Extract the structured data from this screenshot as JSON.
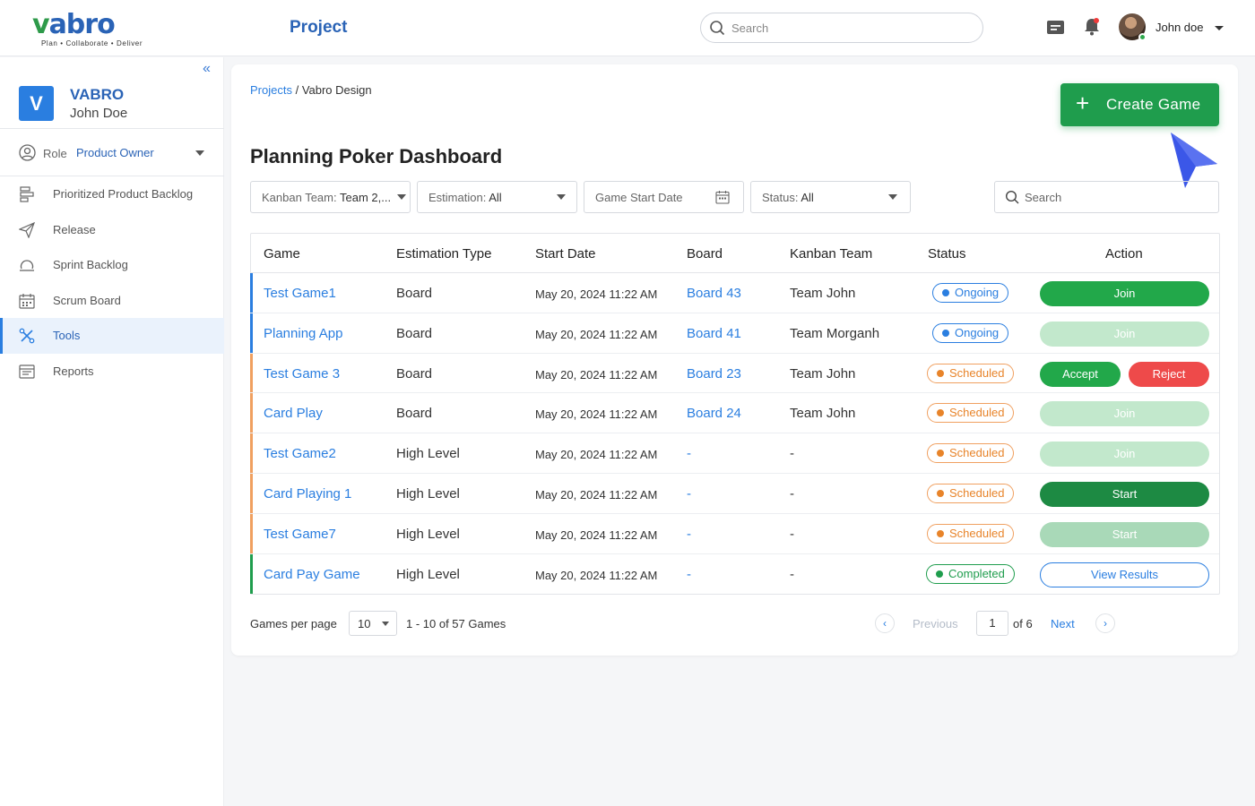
{
  "brand": {
    "logo_word": "vabro",
    "tagline": "Plan • Collaborate • Deliver"
  },
  "header": {
    "title": "Project",
    "search_placeholder": "Search",
    "user_name": "John doe"
  },
  "sidebar": {
    "project_initial": "V",
    "project_name": "VABRO",
    "project_owner": "John Doe",
    "role_label": "Role",
    "role_value": "Product Owner",
    "items": [
      {
        "label": "Prioritized Product Backlog",
        "icon": "backlog-icon"
      },
      {
        "label": "Release",
        "icon": "send-icon"
      },
      {
        "label": "Sprint Backlog",
        "icon": "sprint-icon"
      },
      {
        "label": "Scrum Board",
        "icon": "calendar-icon"
      },
      {
        "label": "Tools",
        "icon": "tools-icon",
        "active": true
      },
      {
        "label": "Reports",
        "icon": "reports-icon"
      }
    ]
  },
  "breadcrumb": {
    "root": "Projects",
    "separator": " / ",
    "current": "Vabro Design"
  },
  "create_button": "Create Game",
  "dashboard_title": "Planning Poker Dashboard",
  "filters": {
    "kanban_label": "Kanban Team:",
    "kanban_value": "Team 2,...",
    "estimation_label": "Estimation:",
    "estimation_value": "All",
    "start_date_placeholder": "Game Start Date",
    "status_label": "Status:",
    "status_value": "All",
    "search_placeholder": "Search"
  },
  "table": {
    "columns": [
      "Game",
      "Estimation Type",
      "Start Date",
      "Board",
      "Kanban Team",
      "Status",
      "Action"
    ],
    "rows": [
      {
        "game": "Test Game1",
        "type": "Board",
        "date": "May 20, 2024 11:22 AM",
        "board": "Board 43",
        "team": "Team John",
        "status": "Ongoing",
        "actions": [
          "Join"
        ]
      },
      {
        "game": "Planning App",
        "type": "Board",
        "date": "May 20, 2024 11:22 AM",
        "board": "Board 41",
        "team": "Team Morganh",
        "status": "Ongoing",
        "actions": [
          "Join"
        ]
      },
      {
        "game": "Test Game 3",
        "type": "Board",
        "date": "May 20, 2024 11:22 AM",
        "board": "Board 23",
        "team": "Team John",
        "status": "Scheduled",
        "actions": [
          "Accept",
          "Reject"
        ]
      },
      {
        "game": "Card Play",
        "type": "Board",
        "date": "May 20, 2024 11:22 AM",
        "board": "Board 24",
        "team": "Team John",
        "status": "Scheduled",
        "actions": [
          "Join"
        ]
      },
      {
        "game": "Test Game2",
        "type": "High Level",
        "date": "May 20, 2024 11:22 AM",
        "board": "-",
        "team": "-",
        "status": "Scheduled",
        "actions": [
          "Join"
        ]
      },
      {
        "game": "Card Playing 1",
        "type": "High Level",
        "date": "May 20, 2024 11:22 AM",
        "board": "-",
        "team": "-",
        "status": "Scheduled",
        "actions": [
          "Start"
        ]
      },
      {
        "game": "Test Game7",
        "type": "High Level",
        "date": "May 20, 2024 11:22 AM",
        "board": "-",
        "team": "-",
        "status": "Scheduled",
        "actions": [
          "Start"
        ]
      },
      {
        "game": "Card Pay Game",
        "type": "High Level",
        "date": "May 20, 2024 11:22 AM",
        "board": "-",
        "team": "-",
        "status": "Completed",
        "actions": [
          "View Results"
        ]
      }
    ]
  },
  "pagination": {
    "per_page_label": "Games per page",
    "per_page_value": "10",
    "range_text": "1 - 10 of 57 Games",
    "previous": "Previous",
    "current_page": "1",
    "of_text": "of 6",
    "next": "Next"
  },
  "colors": {
    "brand_blue": "#2a63b6",
    "link_blue": "#2a7ee0",
    "green": "#1f9d4d",
    "orange": "#e8842a",
    "red": "#ee4a4a"
  }
}
